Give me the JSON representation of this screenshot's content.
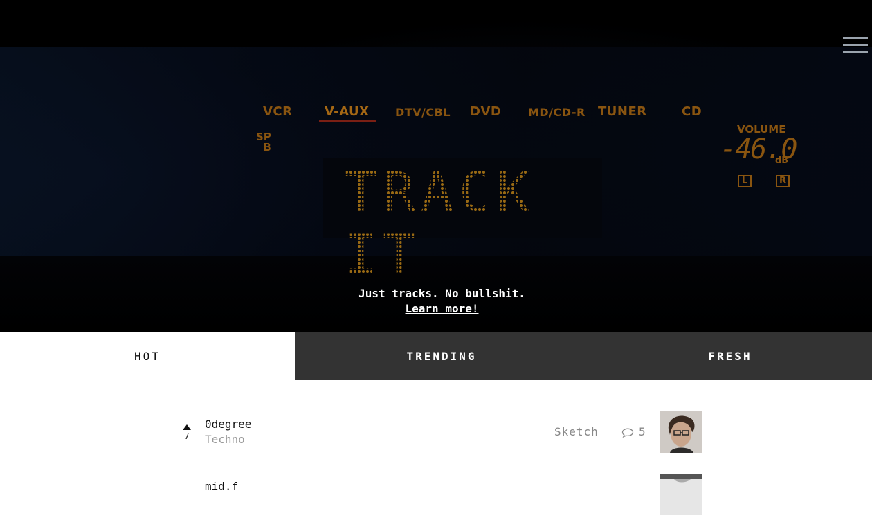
{
  "hero": {
    "sources": [
      "VCR",
      "V-AUX",
      "DTV/CBL",
      "DVD",
      "MD/CD-R",
      "TUNER",
      "CD"
    ],
    "sp_label": "SP",
    "sp_sub": "B",
    "volume_label": "VOLUME",
    "volume_value": "-46.0",
    "volume_unit": "dB",
    "left_indicator": "L",
    "right_indicator": "R",
    "display_text": "TRACK IT",
    "tagline": "Just tracks. No bullshit.",
    "learn_more": "Learn more!"
  },
  "tabs": [
    {
      "label": "HOT",
      "active": true
    },
    {
      "label": "TRENDING",
      "active": false
    },
    {
      "label": "FRESH",
      "active": false
    }
  ],
  "tracks": [
    {
      "votes": "7",
      "title": "0degree",
      "genre": "Techno",
      "tag": "Sketch",
      "comments": "5",
      "avatar_icon": "artist-avatar-photo"
    },
    {
      "votes": "",
      "title": "mid.f",
      "genre": "",
      "tag": "",
      "comments": "",
      "avatar_icon": "artist-avatar-photo"
    }
  ],
  "colors": {
    "accent_amber": "#8a5510",
    "tab_dark": "#333333",
    "muted_text": "#888888"
  }
}
